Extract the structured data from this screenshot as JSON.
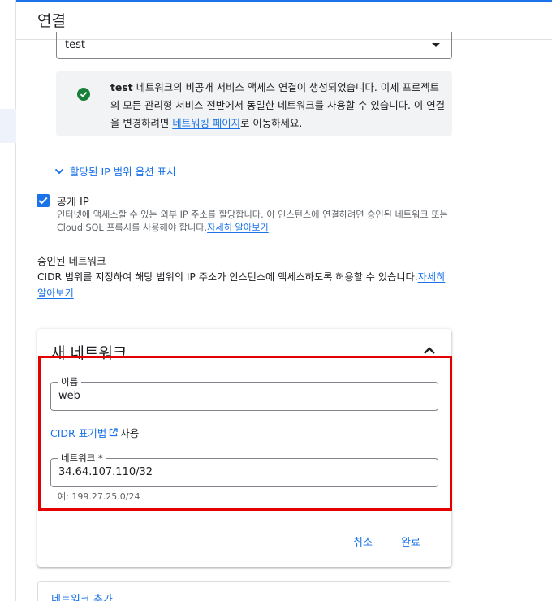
{
  "header": {
    "title": "연결"
  },
  "connection_select": {
    "value": "test"
  },
  "success_banner": {
    "bold": "test",
    "text_before_link": " 네트워크의 비공개 서비스 액세스 연결이 생성되었습니다. 이제 프로젝트의 모든 관리형 서비스 전반에서 동일한 네트워크를 사용할 수 있습니다. 이 연결을 변경하려면 ",
    "link": "네트워킹 페이지",
    "text_after_link": "로 이동하세요.",
    "icon": "check-circle-icon"
  },
  "ip_range_toggle": {
    "label": "할당된 IP 범위 옵션 표시"
  },
  "public_ip": {
    "label": "공개 IP",
    "checked": true,
    "description": "인터넷에 액세스할 수 있는 외부 IP 주소를 할당합니다. 이 인스턴스에 연결하려면 승인된 네트워크 또는 Cloud SQL 프록시를 사용해야 합니다.",
    "learn_more": "자세히 알아보기"
  },
  "authorized_networks": {
    "title": "승인된 네트워크",
    "description": "CIDR 범위를 지정하여 해당 범위의 IP 주소가 인스턴스에 액세스하도록 허용할 수 있습니다.",
    "learn_more": "자세히 알아보기"
  },
  "new_network": {
    "title": "새 네트워크",
    "name_label": "이름",
    "name_value": "web",
    "cidr_link": "CIDR 표기법",
    "cidr_suffix": "사용",
    "network_label": "네트워크 *",
    "network_value": "34.64.107.110/32",
    "network_hint": "예: 199.27.25.0/24",
    "cancel_label": "취소",
    "done_label": "완료"
  },
  "add_network": {
    "label": "네트워크 추가"
  },
  "colors": {
    "accent": "#1a73e8",
    "success": "#188038",
    "highlight": "#e50000"
  }
}
